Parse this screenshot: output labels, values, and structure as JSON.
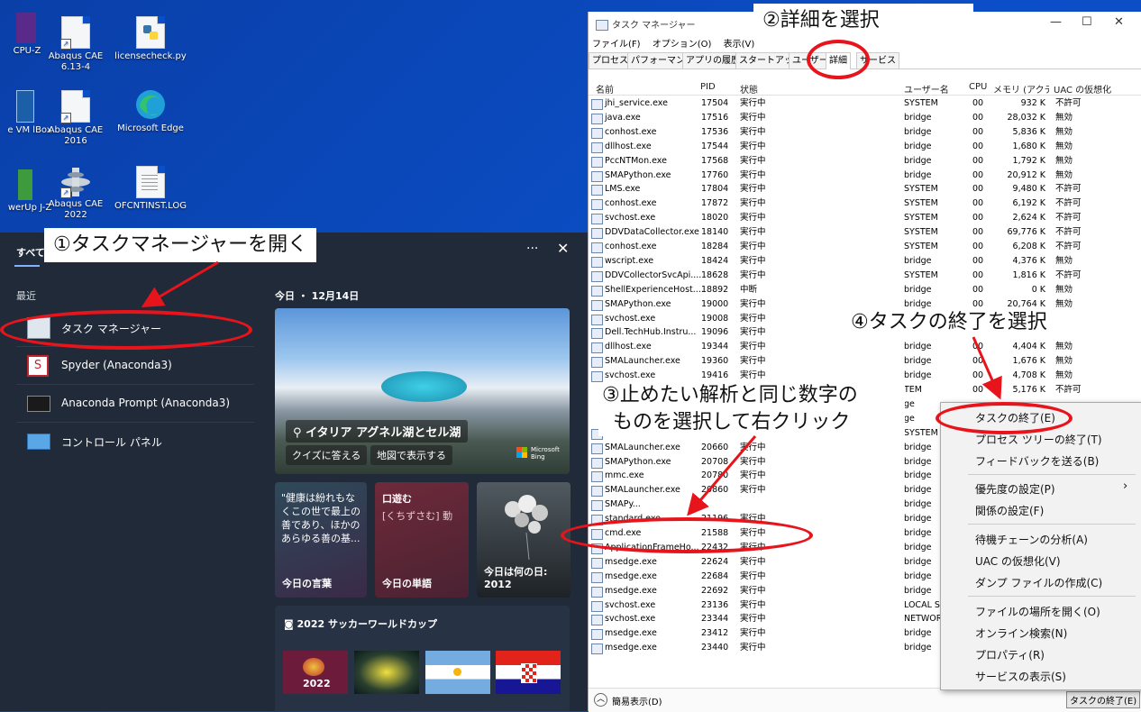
{
  "desktop_icons": [
    {
      "label": "CPU-Z",
      "icon": "cpuz-icon"
    },
    {
      "label": "Abaqus CAE 6.13-4",
      "icon": "document-icon"
    },
    {
      "label": "licensecheck.py",
      "icon": "python-file-icon"
    },
    {
      "label": "e VM lBox",
      "icon": "virtualbox-icon"
    },
    {
      "label": "Abaqus CAE 2016",
      "icon": "document-icon"
    },
    {
      "label": "Microsoft Edge",
      "icon": "edge-icon"
    },
    {
      "label": "werUp J-Z",
      "icon": "app-icon"
    },
    {
      "label": "Abaqus CAE 2022",
      "icon": "abaqus-icon"
    },
    {
      "label": "OFCNTINST.LOG",
      "icon": "log-file-icon"
    }
  ],
  "start_panel": {
    "tab_all": "すべて",
    "more": "···",
    "close": "✕",
    "recent_label": "最近",
    "recent_items": [
      {
        "label": "タスク マネージャー",
        "icon": "task-manager-icon"
      },
      {
        "label": "Spyder (Anaconda3)",
        "icon": "spyder-icon"
      },
      {
        "label": "Anaconda Prompt (Anaconda3)",
        "icon": "terminal-icon"
      },
      {
        "label": "コントロール パネル",
        "icon": "control-panel-icon"
      }
    ],
    "today_label": "今日 ・ 12月14日",
    "hero": {
      "caption": "イタリア アグネル湖とセル湖",
      "button_quiz": "クイズに答える",
      "button_map": "地図で表示する",
      "brand": "Microsoft Bing"
    },
    "cards": [
      {
        "text": "\"健康は紛れもなくこの世で最上の善であり、ほかのあらゆる善の基...",
        "title": "今日の言葉"
      },
      {
        "text": "口遊む",
        "sub": "[くちずさむ] 動",
        "title": "今日の単語"
      },
      {
        "title": "今日は何の日: 2012"
      }
    ],
    "cup_title": "2022 サッカーワールドカップ",
    "cup_logo": "2022"
  },
  "task_manager": {
    "title": "タスク マネージャー",
    "menu": [
      "ファイル(F)",
      "オプション(O)",
      "表示(V)"
    ],
    "tabs": [
      "プロセス",
      "パフォーマンス",
      "アプリの履歴",
      "スタートアップ",
      "ユーザー",
      "詳細",
      "サービス"
    ],
    "columns": [
      "名前",
      "PID",
      "状態",
      "ユーザー名",
      "CPU",
      "メモリ (アクティ...",
      "UAC の仮想化"
    ],
    "rows": [
      [
        "jhi_service.exe",
        "17504",
        "実行中",
        "SYSTEM",
        "00",
        "932 K",
        "不許可"
      ],
      [
        "java.exe",
        "17516",
        "実行中",
        "bridge",
        "00",
        "28,032 K",
        "無効"
      ],
      [
        "conhost.exe",
        "17536",
        "実行中",
        "bridge",
        "00",
        "5,836 K",
        "無効"
      ],
      [
        "dllhost.exe",
        "17544",
        "実行中",
        "bridge",
        "00",
        "1,680 K",
        "無効"
      ],
      [
        "PccNTMon.exe",
        "17568",
        "実行中",
        "bridge",
        "00",
        "1,792 K",
        "無効"
      ],
      [
        "SMAPython.exe",
        "17760",
        "実行中",
        "bridge",
        "00",
        "20,912 K",
        "無効"
      ],
      [
        "LMS.exe",
        "17804",
        "実行中",
        "SYSTEM",
        "00",
        "9,480 K",
        "不許可"
      ],
      [
        "conhost.exe",
        "17872",
        "実行中",
        "SYSTEM",
        "00",
        "6,192 K",
        "不許可"
      ],
      [
        "svchost.exe",
        "18020",
        "実行中",
        "SYSTEM",
        "00",
        "2,624 K",
        "不許可"
      ],
      [
        "DDVDataCollector.exe",
        "18140",
        "実行中",
        "SYSTEM",
        "00",
        "69,776 K",
        "不許可"
      ],
      [
        "conhost.exe",
        "18284",
        "実行中",
        "SYSTEM",
        "00",
        "6,208 K",
        "不許可"
      ],
      [
        "wscript.exe",
        "18424",
        "実行中",
        "bridge",
        "00",
        "4,376 K",
        "無効"
      ],
      [
        "DDVCollectorSvcApi....",
        "18628",
        "実行中",
        "SYSTEM",
        "00",
        "1,816 K",
        "不許可"
      ],
      [
        "ShellExperienceHost....",
        "18892",
        "中断",
        "bridge",
        "00",
        "0 K",
        "無効"
      ],
      [
        "SMAPython.exe",
        "19000",
        "実行中",
        "bridge",
        "00",
        "20,764 K",
        "無効"
      ],
      [
        "svchost.exe",
        "19008",
        "実行中",
        "",
        "",
        "",
        ""
      ],
      [
        "Dell.TechHub.Instru...",
        "19096",
        "実行中",
        "",
        "",
        "",
        ""
      ],
      [
        "dllhost.exe",
        "19344",
        "実行中",
        "bridge",
        "00",
        "4,404 K",
        "無効"
      ],
      [
        "SMALauncher.exe",
        "19360",
        "実行中",
        "bridge",
        "00",
        "1,676 K",
        "無効"
      ],
      [
        "svchost.exe",
        "19416",
        "実行中",
        "bridge",
        "00",
        "4,708 K",
        "無効"
      ],
      [
        "",
        "",
        "",
        "TEM",
        "00",
        "5,176 K",
        "不許可"
      ],
      [
        "",
        "",
        "",
        "ge",
        "",
        "",
        ""
      ],
      [
        "",
        "",
        "",
        "ge",
        "",
        "",
        ""
      ],
      [
        "svchost.exe",
        "20552",
        "実行中",
        "SYSTEM",
        "",
        "",
        ""
      ],
      [
        "SMALauncher.exe",
        "20660",
        "実行中",
        "bridge",
        "",
        "",
        ""
      ],
      [
        "SMAPython.exe",
        "20708",
        "実行中",
        "bridge",
        "",
        "",
        ""
      ],
      [
        "mmc.exe",
        "20780",
        "実行中",
        "bridge",
        "",
        "",
        ""
      ],
      [
        "SMALauncher.exe",
        "20860",
        "実行中",
        "bridge",
        "",
        "",
        ""
      ],
      [
        "SMAPy...",
        "",
        "",
        "bridge",
        "",
        "",
        ""
      ],
      [
        "standard.exe",
        "21196",
        "実行中",
        "bridge",
        "",
        "",
        ""
      ],
      [
        "cmd.exe",
        "21588",
        "実行中",
        "bridge",
        "",
        "",
        ""
      ],
      [
        "ApplicationFrameHo...",
        "22432",
        "実行中",
        "bridge",
        "",
        "",
        ""
      ],
      [
        "msedge.exe",
        "22624",
        "実行中",
        "bridge",
        "",
        "",
        ""
      ],
      [
        "msedge.exe",
        "22684",
        "実行中",
        "bridge",
        "",
        "",
        ""
      ],
      [
        "msedge.exe",
        "22692",
        "実行中",
        "bridge",
        "",
        "",
        ""
      ],
      [
        "svchost.exe",
        "23136",
        "実行中",
        "LOCAL SE",
        "",
        "",
        ""
      ],
      [
        "svchost.exe",
        "23344",
        "実行中",
        "NETWOR",
        "",
        "",
        ""
      ],
      [
        "msedge.exe",
        "23412",
        "実行中",
        "bridge",
        "",
        "",
        ""
      ],
      [
        "msedge.exe",
        "23440",
        "実行中",
        "bridge",
        "",
        "",
        ""
      ]
    ],
    "footer_left": "簡易表示(D)",
    "footer_right": "タスクの終了(E)"
  },
  "context_menu": {
    "items": [
      "タスクの終了(E)",
      "プロセス ツリーの終了(T)",
      "フィードバックを送る(B)",
      "優先度の設定(P)",
      "関係の設定(F)",
      "待機チェーンの分析(A)",
      "UAC の仮想化(V)",
      "ダンプ ファイルの作成(C)",
      "ファイルの場所を開く(O)",
      "オンライン検索(N)",
      "プロパティ(R)",
      "サービスの表示(S)"
    ]
  },
  "annotations": {
    "step1": "①タスクマネージャーを開く",
    "step2": "②詳細を選択",
    "step3_line1": "③止めたい解析と同じ数字の",
    "step3_line2": "ものを選択して右クリック",
    "step4": "④タスクの終了を選択"
  },
  "colors": {
    "accent": "#e8141c",
    "desktop": "#0b4fc8",
    "panel": "#202a38"
  }
}
